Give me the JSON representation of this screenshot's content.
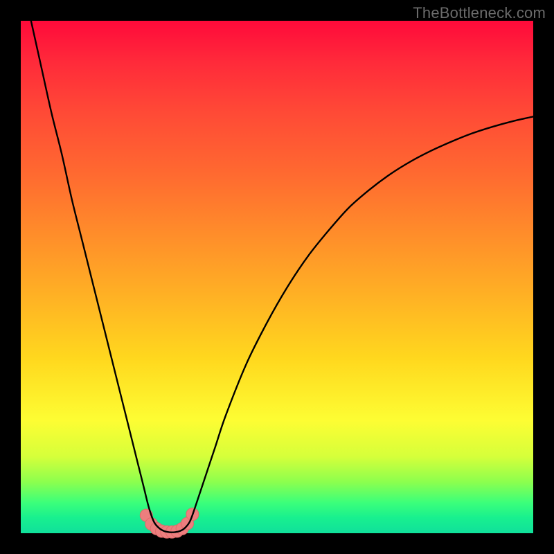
{
  "watermark": "TheBottleneck.com",
  "chart_data": {
    "type": "line",
    "title": "",
    "xlabel": "",
    "ylabel": "",
    "xlim": [
      0,
      100
    ],
    "ylim": [
      0,
      100
    ],
    "series": [
      {
        "name": "bottleneck-curve",
        "x": [
          2,
          4,
          6,
          8,
          10,
          12,
          14,
          16,
          18,
          20,
          22,
          23,
          24,
          25,
          26,
          27,
          28,
          29,
          30,
          31,
          32,
          33,
          34,
          36,
          38,
          40,
          44,
          48,
          52,
          56,
          60,
          64,
          68,
          72,
          76,
          80,
          84,
          88,
          92,
          96,
          100
        ],
        "y": [
          100,
          91,
          82,
          74,
          65,
          57,
          49,
          41,
          33,
          25,
          17,
          13,
          9,
          5,
          2.2,
          1,
          0.4,
          0.2,
          0.2,
          0.4,
          1,
          2.3,
          5,
          11,
          17,
          23,
          33,
          41,
          48,
          54,
          59,
          63.5,
          67,
          70,
          72.5,
          74.6,
          76.4,
          78,
          79.3,
          80.4,
          81.3
        ]
      }
    ],
    "markers": {
      "name": "trough-markers",
      "color": "#ed7e7e",
      "stroke": "#e06a6a",
      "radius_px": 9,
      "x": [
        24.5,
        25.5,
        26.5,
        27.5,
        28.5,
        29.5,
        30.5,
        31.5,
        32.5,
        33.5
      ],
      "y": [
        3.5,
        1.8,
        0.9,
        0.4,
        0.25,
        0.25,
        0.4,
        0.9,
        1.9,
        3.7
      ]
    }
  }
}
